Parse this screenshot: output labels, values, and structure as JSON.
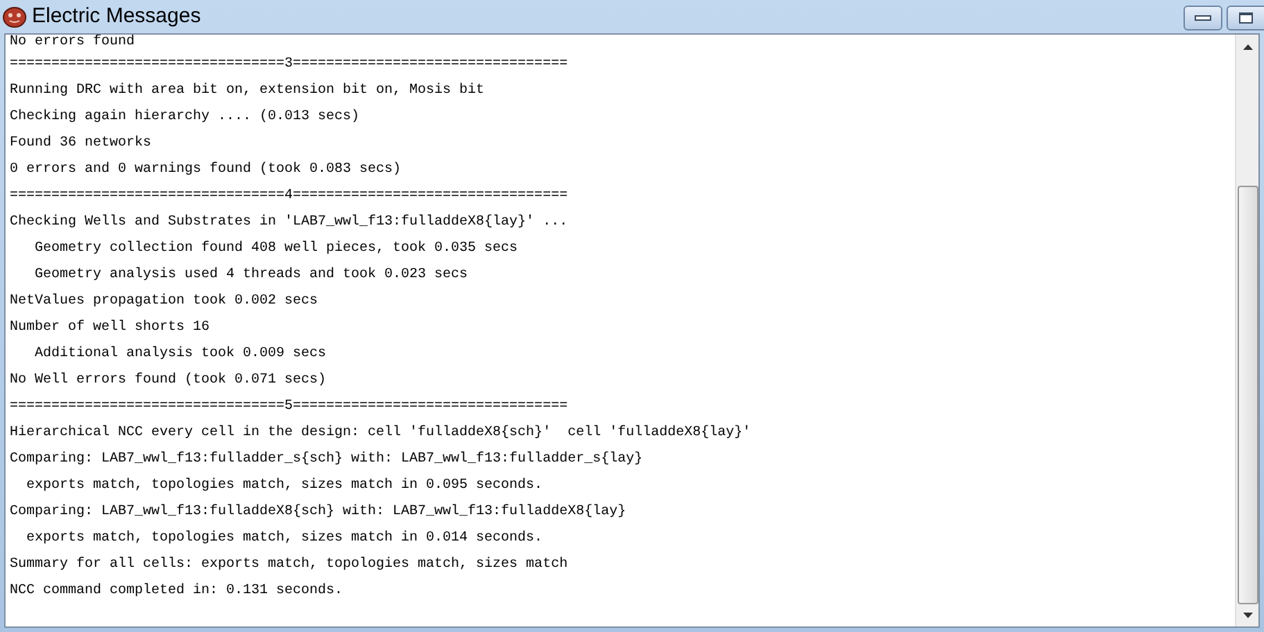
{
  "window": {
    "title": "Electric Messages"
  },
  "messages": [
    "No errors found",
    "=================================3=================================",
    "Running DRC with area bit on, extension bit on, Mosis bit",
    "Checking again hierarchy .... (0.013 secs)",
    "Found 36 networks",
    "0 errors and 0 warnings found (took 0.083 secs)",
    "=================================4=================================",
    "Checking Wells and Substrates in 'LAB7_wwl_f13:fulladdeX8{lay}' ...",
    "   Geometry collection found 408 well pieces, took 0.035 secs",
    "   Geometry analysis used 4 threads and took 0.023 secs",
    "NetValues propagation took 0.002 secs",
    "Number of well shorts 16",
    "   Additional analysis took 0.009 secs",
    "No Well errors found (took 0.071 secs)",
    "=================================5=================================",
    "Hierarchical NCC every cell in the design: cell 'fulladdeX8{sch}'  cell 'fulladdeX8{lay}'",
    "Comparing: LAB7_wwl_f13:fulladder_s{sch} with: LAB7_wwl_f13:fulladder_s{lay}",
    "  exports match, topologies match, sizes match in 0.095 seconds.",
    "Comparing: LAB7_wwl_f13:fulladdeX8{sch} with: LAB7_wwl_f13:fulladdeX8{lay}",
    "  exports match, topologies match, sizes match in 0.014 seconds.",
    "Summary for all cells: exports match, topologies match, sizes match",
    "NCC command completed in: 0.131 seconds."
  ]
}
